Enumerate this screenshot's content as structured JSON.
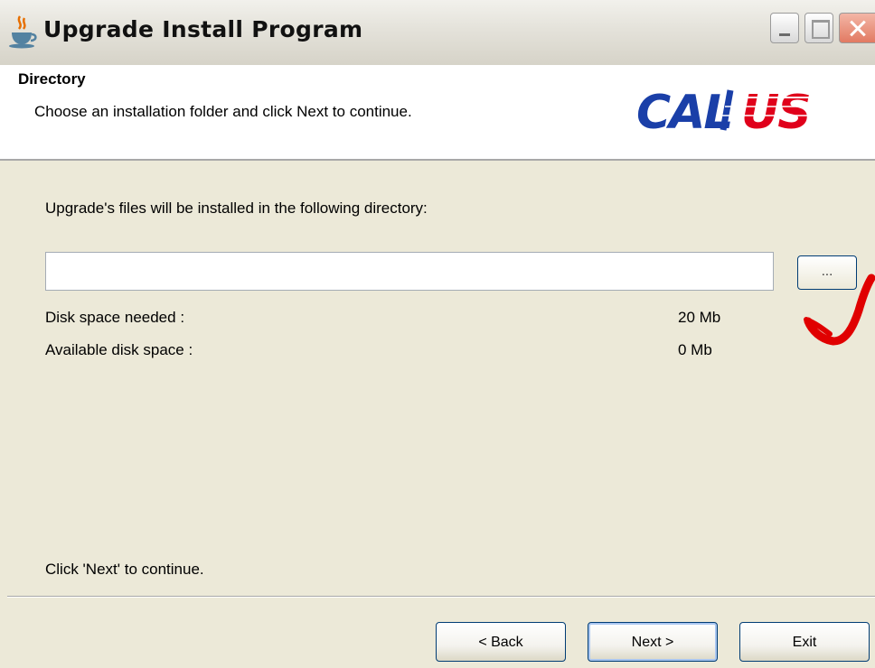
{
  "window": {
    "title": "Upgrade Install Program"
  },
  "header": {
    "title": "Directory",
    "subtitle": "Choose an installation folder and click Next to continue.",
    "logo_text": "CALLUS"
  },
  "main": {
    "dir_label": "Upgrade's files will be installed in the following directory:",
    "dir_value": "",
    "browse_label": "...",
    "disk_needed_label": "Disk space needed :",
    "disk_needed_value": "20 Mb",
    "disk_available_label": "Available disk space :",
    "disk_available_value": "0 Mb",
    "footer_note": "Click 'Next' to continue."
  },
  "buttons": {
    "back_label": "< Back",
    "next_label": "Next >",
    "exit_label": "Exit"
  },
  "colors": {
    "window_bg": "#ece9d8",
    "logo_blue": "#1a3fa8",
    "logo_red": "#e0001b",
    "annotation_red": "#e00000"
  }
}
